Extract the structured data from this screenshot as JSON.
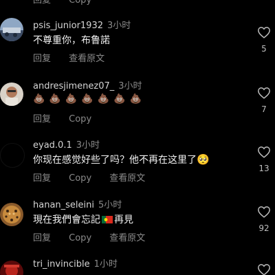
{
  "top_partial": {
    "reply_label": "回复",
    "copy_label": "Copy"
  },
  "comments": [
    {
      "username": "psis_junior1932",
      "time": "3小时",
      "text": "不尊重你，布鲁諾",
      "reply_label": "回复",
      "translate_label": "查看原文",
      "likes": "5"
    },
    {
      "username": "andresjimenez07_",
      "time": "3小时",
      "text": "💩💩💩💩💩💩💩",
      "reply_label": "回复",
      "copy_label": "Copy",
      "likes": "7"
    },
    {
      "username": "eyad.0.1",
      "time": "3小时",
      "text": "你现在感觉好些了吗？他不再在这里了",
      "emoji": "🥺",
      "reply_label": "回复",
      "copy_label": "Copy",
      "translate_label": "查看原文",
      "likes": "13"
    },
    {
      "username": "hanan_seleini",
      "time": "5小时",
      "text_before": "現在我們會忘記",
      "text_after": "再見",
      "flag": "portugal-flag",
      "reply_label": "回复",
      "copy_label": "Copy",
      "translate_label": "查看原文",
      "likes": "92"
    },
    {
      "username": "tri_invincible",
      "time": "1小时"
    }
  ],
  "colors": {
    "background": "#000000",
    "muted": "#8a8a8a",
    "text": "#f2f2f2"
  }
}
